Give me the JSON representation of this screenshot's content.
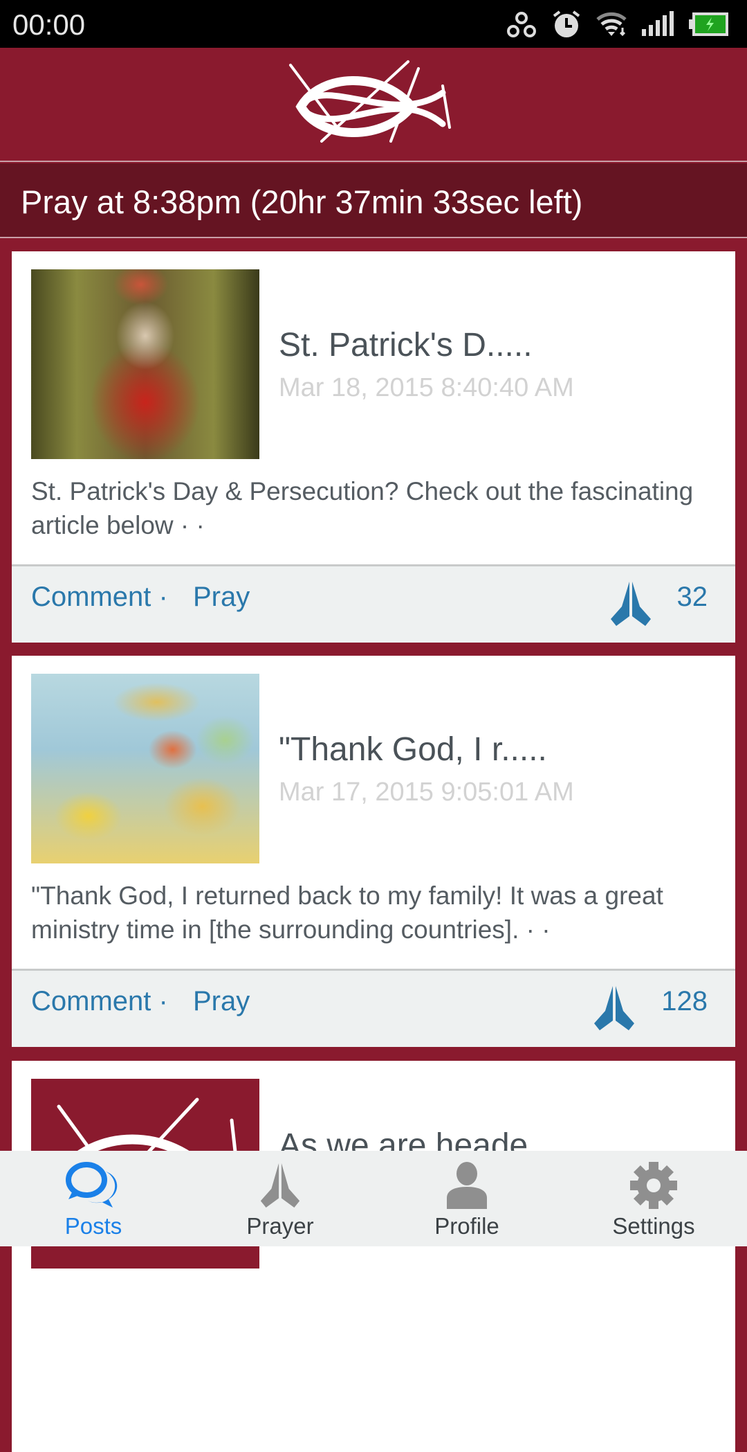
{
  "status_bar": {
    "time": "00:00",
    "icons": [
      "hotspot-icon",
      "alarm-icon",
      "wifi-icon",
      "signal-icon",
      "battery-charging-icon"
    ],
    "battery_color": "#1fa31f"
  },
  "header": {
    "logo": "ichthys-fish-logo"
  },
  "countdown": {
    "text": "Pray at 8:38pm (20hr 37min 33sec left)"
  },
  "colors": {
    "brand": "#8a1a2e",
    "accent": "#2a78ab",
    "nav_active": "#1a80e8"
  },
  "posts": [
    {
      "title": "St. Patrick's D.....",
      "date": "Mar 18, 2015 8:40:40 AM",
      "body": "St. Patrick's Day & Persecution? Check out the fascinating article below · ·",
      "comment_label": "Comment ·",
      "pray_label": "Pray",
      "pray_count": "32",
      "image": "stained-glass-saint"
    },
    {
      "title": "\"Thank God, I r.....",
      "date": "Mar 17, 2015 9:05:01 AM",
      "body": "\"Thank God, I returned back to my family! It was a great ministry time in [the surrounding countries]. · ·",
      "comment_label": "Comment ·",
      "pray_label": "Pray",
      "pray_count": "128",
      "image": "middle-east-map"
    },
    {
      "title": "As we are heade",
      "image": "ichthys-logo"
    }
  ],
  "nav": [
    {
      "label": "Posts",
      "icon": "chat-bubbles-icon",
      "active": true
    },
    {
      "label": "Prayer",
      "icon": "praying-hands-icon"
    },
    {
      "label": "Profile",
      "icon": "user-icon"
    },
    {
      "label": "Settings",
      "icon": "gear-icon"
    }
  ]
}
